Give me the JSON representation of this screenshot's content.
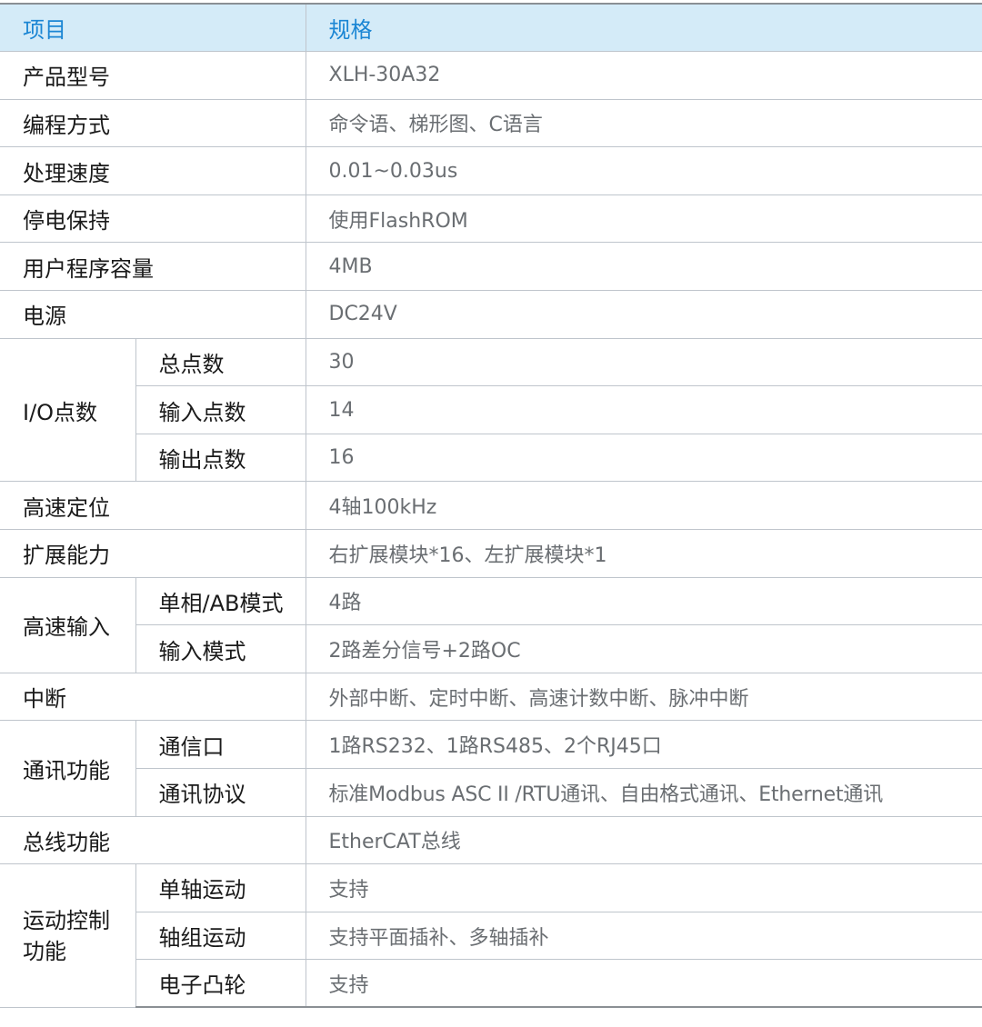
{
  "header": {
    "item": "项目",
    "spec": "规格"
  },
  "rows": {
    "model": {
      "label": "产品型号",
      "value": "XLH-30A32"
    },
    "programming": {
      "label": "编程方式",
      "value": "命令语、梯形图、C语言"
    },
    "speed": {
      "label": "处理速度",
      "value": "0.01~0.03us"
    },
    "retention": {
      "label": "停电保持",
      "value": "使用FlashROM"
    },
    "capacity": {
      "label": "用户程序容量",
      "value": "4MB"
    },
    "power": {
      "label": "电源",
      "value": "DC24V"
    },
    "io": {
      "label": "I/O点数",
      "total": {
        "label": "总点数",
        "value": "30"
      },
      "inputs": {
        "label": "输入点数",
        "value": "14"
      },
      "outputs": {
        "label": "输出点数",
        "value": "16"
      }
    },
    "positioning": {
      "label": "高速定位",
      "value": "4轴100kHz"
    },
    "expansion": {
      "label": "扩展能力",
      "value": "右扩展模块*16、左扩展模块*1"
    },
    "hs_input": {
      "label": "高速输入",
      "phase": {
        "label": "单相/AB模式",
        "value": "4路"
      },
      "mode": {
        "label": "输入模式",
        "value": "2路差分信号+2路OC"
      }
    },
    "interrupt": {
      "label": "中断",
      "value": "外部中断、定时中断、高速计数中断、脉冲中断"
    },
    "comm": {
      "label": "通讯功能",
      "ports": {
        "label": "通信口",
        "value": "1路RS232、1路RS485、2个RJ45口"
      },
      "protocol": {
        "label": "通讯协议",
        "value": "标准Modbus ASC II /RTU通讯、自由格式通讯、Ethernet通讯"
      }
    },
    "bus": {
      "label": "总线功能",
      "value": "EtherCAT总线"
    },
    "motion": {
      "label": "运动控制功能",
      "single_axis": {
        "label": "单轴运动",
        "value": "支持"
      },
      "axis_group": {
        "label": "轴组运动",
        "value": "支持平面插补、多轴插补"
      },
      "cam": {
        "label": "电子凸轮",
        "value": "支持"
      }
    }
  }
}
